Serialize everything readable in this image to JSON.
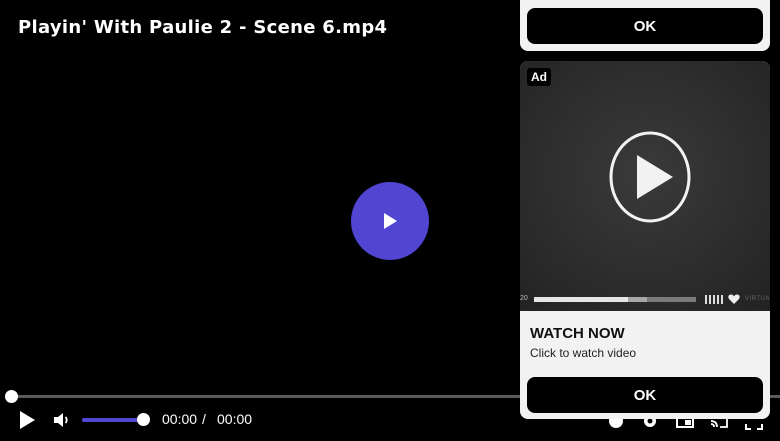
{
  "player": {
    "title": "Playin' With Paulie 2 - Scene 6.mp4",
    "accent_color": "#5046d2",
    "seek_progress": 0.0,
    "volume_level": 1.0,
    "time_current": "00:00",
    "time_separator": "/",
    "time_total": "00:00",
    "controls": {
      "play_icon": "play-icon",
      "volume_icon": "volume-icon",
      "right_icons": [
        "chromecast-icon",
        "settings-icon",
        "picture-in-picture-icon",
        "cast-icon",
        "fullscreen-icon"
      ]
    }
  },
  "ad_top": {
    "ok_label": "OK"
  },
  "ad": {
    "badge": "Ad",
    "heading": "WATCH NOW",
    "subtext": "Click to watch video",
    "ok_label": "OK",
    "media_progress": 0.58,
    "media_buffered": 0.7,
    "media_time_label": "20",
    "media_brand": "VIRTUA"
  }
}
